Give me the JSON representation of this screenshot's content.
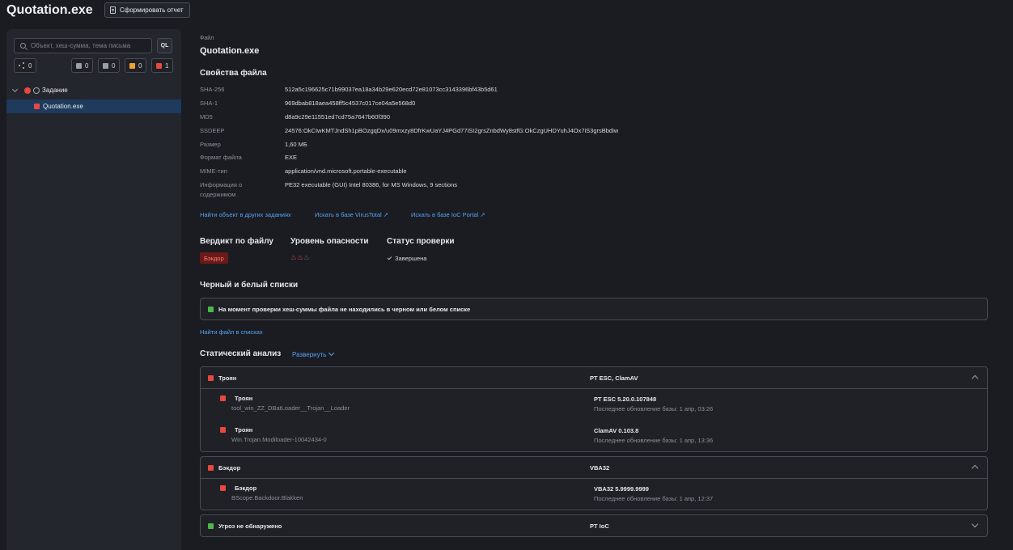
{
  "header": {
    "title": "Quotation.exe",
    "report_button": "Сформировать отчет"
  },
  "sidebar": {
    "search_placeholder": "Объект, хеш-сумма, тема письма",
    "ql_button": "QL",
    "chips": [
      {
        "icon": "share-icon",
        "count": "0"
      },
      {
        "icon": "gray-square",
        "color": "#9a9ea8",
        "count": "0"
      },
      {
        "icon": "gray-square",
        "color": "#9a9ea8",
        "count": "0"
      },
      {
        "icon": "orange-square",
        "color": "#f0a030",
        "count": "0"
      },
      {
        "icon": "red-square",
        "color": "#e8483f",
        "count": "1"
      }
    ],
    "tree": {
      "task_label": "Задание",
      "file_label": "Quotation.exe"
    }
  },
  "main": {
    "file_label": "Файл",
    "file_name": "Quotation.exe",
    "props_title": "Свойства файла",
    "props": [
      {
        "k": "SHA-256",
        "v": "512a5c196625c71b99037ea18a34b29e620ecd72e81073cc3143396bf43b5d61"
      },
      {
        "k": "SHA-1",
        "v": "969dbab818aea458ff5c4537c017ce04a5e568d0"
      },
      {
        "k": "MD5",
        "v": "d8a9c29e11551ed7cd75a7647b60f390"
      },
      {
        "k": "SSDEEP",
        "v": "24576:OkCIwKMTJndSh1pBOzgqDx/u09mxzy8DfrKwUaYJ4PGd77iSI2grsZnbdWy8stfG:OkCzgUHDYuhJ4Ox7iS3grsBbdiw"
      },
      {
        "k": "Размер",
        "v": "1,60 МБ"
      },
      {
        "k": "Формат файла",
        "v": "EXE"
      },
      {
        "k": "MIME-тип",
        "v": "application/vnd.microsoft.portable-executable"
      },
      {
        "k": "Информация о содержимом",
        "v": "PE32 executable (GUI) Intel 80386, for MS Windows, 9 sections"
      }
    ],
    "links": {
      "find_other": "Найти объект в других заданиях",
      "virustotal": "Искать в базе VirusTotal ↗",
      "iocportal": "Искать в базе IoC Portal ↗"
    },
    "verdict_title": "Вердикт по файлу",
    "verdict_badge": "Бэкдор",
    "danger_title": "Уровень опасности",
    "danger_level": {
      "value": 2,
      "max": 3
    },
    "status_title": "Статус проверки",
    "status_value": "Завершена",
    "lists_title": "Черный и белый списки",
    "lists_message": "На момент проверки хеш-суммы файла не находились в черном или белом списке",
    "find_in_lists": "Найти файл в списках",
    "static_title": "Статический анализ",
    "expand_label": "Развернуть",
    "panels": [
      {
        "title": "Троян",
        "source": "PT ESC, ClamAV",
        "color": "#e8483f",
        "items": [
          {
            "type": "Троян",
            "name": "tool_win_ZZ_DBatLoader__Trojan__Loader",
            "engine": "PT ESC 5.20.0.107848",
            "updated": "Последнее обновление базы: 1 апр, 03:26"
          },
          {
            "type": "Троян",
            "name": "Win.Trojan.Modiloader-10042434-0",
            "engine": "ClamAV 0.103.8",
            "updated": "Последнее обновление базы: 1 апр, 13:36"
          }
        ]
      },
      {
        "title": "Бэкдор",
        "source": "VBA32",
        "color": "#e8483f",
        "items": [
          {
            "type": "Бэкдор",
            "name": "BScope.Backdoor.Blakken",
            "engine": "VBA32 5.9999.9999",
            "updated": "Последнее обновление базы: 1 апр, 12:37"
          }
        ]
      },
      {
        "title": "Угроз не обнаружено",
        "source": "PT IoC",
        "color": "#4cb84a",
        "items": []
      }
    ]
  }
}
